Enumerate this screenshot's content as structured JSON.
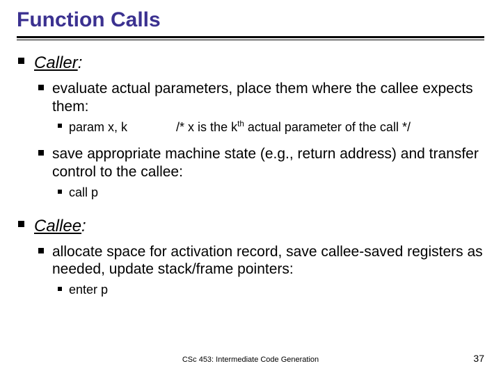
{
  "title": "Function Calls",
  "sections": [
    {
      "heading_underlined": "Caller",
      "heading_tail": ":",
      "items": [
        {
          "text": "evaluate actual parameters, place them where the callee expects them:",
          "sub": [
            {
              "pre": "param x, k",
              "post_a": "/* x is the k",
              "sup": "th",
              "post_b": " actual parameter of the call */"
            }
          ]
        },
        {
          "text": "save appropriate machine state (e.g., return address) and transfer control to the callee:",
          "sub": [
            {
              "plain": "call p"
            }
          ]
        }
      ]
    },
    {
      "heading_underlined": "Callee",
      "heading_tail": ":",
      "items": [
        {
          "text": "allocate space for activation record, save callee-saved registers as needed, update stack/frame pointers:",
          "sub": [
            {
              "plain": "enter p"
            }
          ]
        }
      ]
    }
  ],
  "footer": {
    "center": "CSc 453: Intermediate Code Generation",
    "page": "37"
  }
}
